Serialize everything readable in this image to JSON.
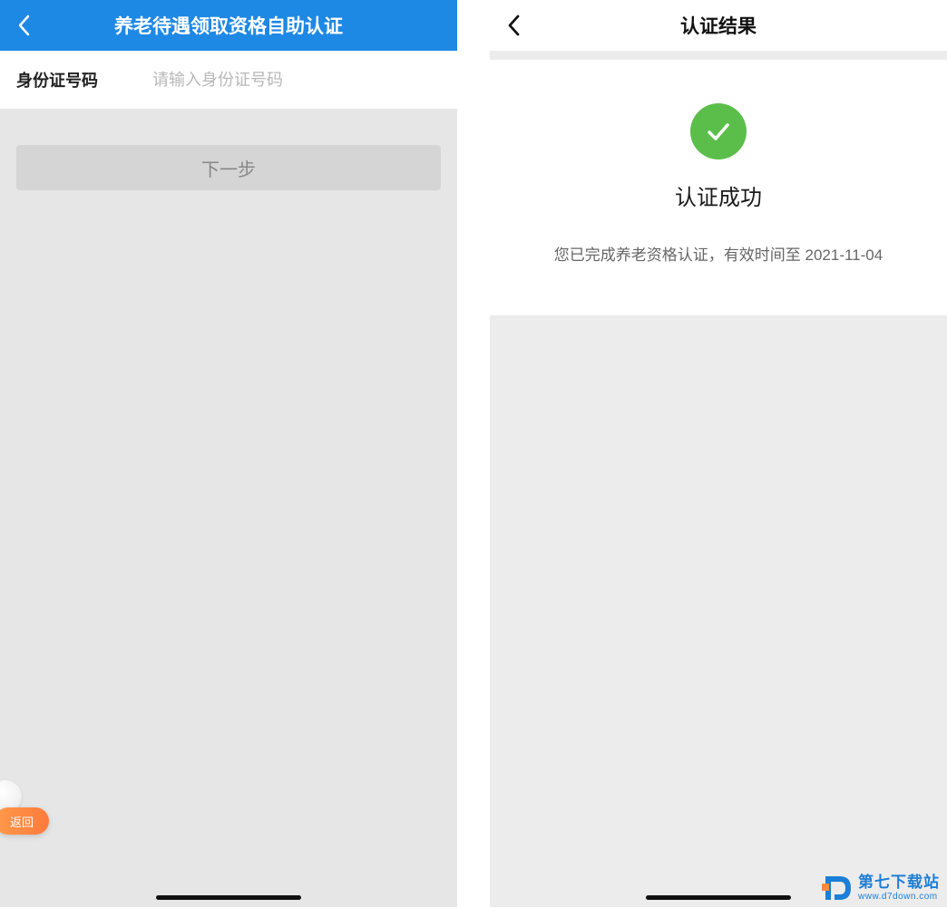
{
  "left": {
    "header_title": "养老待遇领取资格自助认证",
    "id_label": "身份证号码",
    "id_placeholder": "请输入身份证号码",
    "next_button": "下一步",
    "float_back_label": "返回"
  },
  "right": {
    "header_title": "认证结果",
    "result_title": "认证成功",
    "result_desc": "您已完成养老资格认证，有效时间至 2021-11-04"
  },
  "watermark": {
    "site_name": "第七下载站",
    "site_url": "www.d7down.com"
  },
  "colors": {
    "primary_blue": "#1E88E5",
    "success_green": "#5cbe4a",
    "float_orange": "#ff7a3c"
  }
}
